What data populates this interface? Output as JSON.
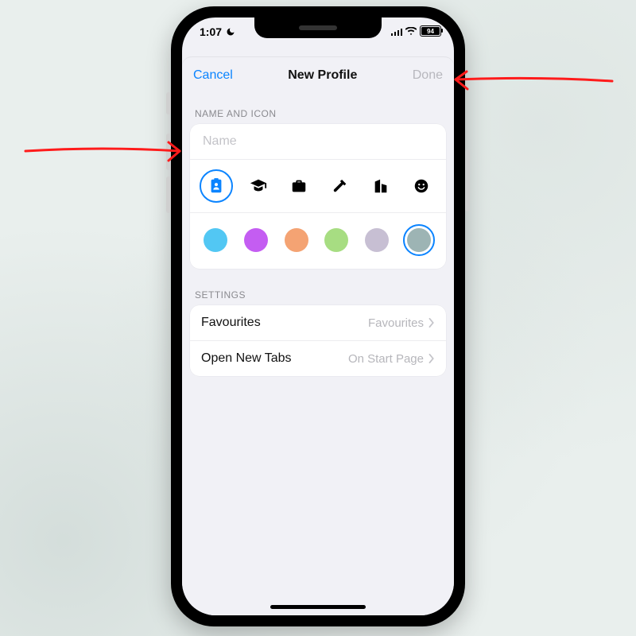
{
  "status": {
    "time": "1:07",
    "battery_pct": "94"
  },
  "nav": {
    "cancel": "Cancel",
    "title": "New Profile",
    "done": "Done"
  },
  "sections": {
    "name_icon_header": "NAME AND ICON",
    "settings_header": "SETTINGS"
  },
  "name_field": {
    "placeholder": "Name",
    "value": ""
  },
  "icons": [
    {
      "id": "badge",
      "name": "profile-badge-icon",
      "selected": true
    },
    {
      "id": "grad",
      "name": "graduation-cap-icon",
      "selected": false
    },
    {
      "id": "briefcase",
      "name": "briefcase-icon",
      "selected": false
    },
    {
      "id": "hammer",
      "name": "hammer-icon",
      "selected": false
    },
    {
      "id": "building",
      "name": "building-icon",
      "selected": false
    },
    {
      "id": "smiley",
      "name": "smiley-icon",
      "selected": false
    }
  ],
  "colors": [
    {
      "hex": "#52c7f3",
      "selected": false
    },
    {
      "hex": "#c45df2",
      "selected": false
    },
    {
      "hex": "#f4a373",
      "selected": false
    },
    {
      "hex": "#a7dd82",
      "selected": false
    },
    {
      "hex": "#c7bfd3",
      "selected": false
    },
    {
      "hex": "#9db4b4",
      "selected": true
    }
  ],
  "settings": {
    "favourites": {
      "label": "Favourites",
      "value": "Favourites"
    },
    "new_tabs": {
      "label": "Open New Tabs",
      "value": "On Start Page"
    }
  }
}
